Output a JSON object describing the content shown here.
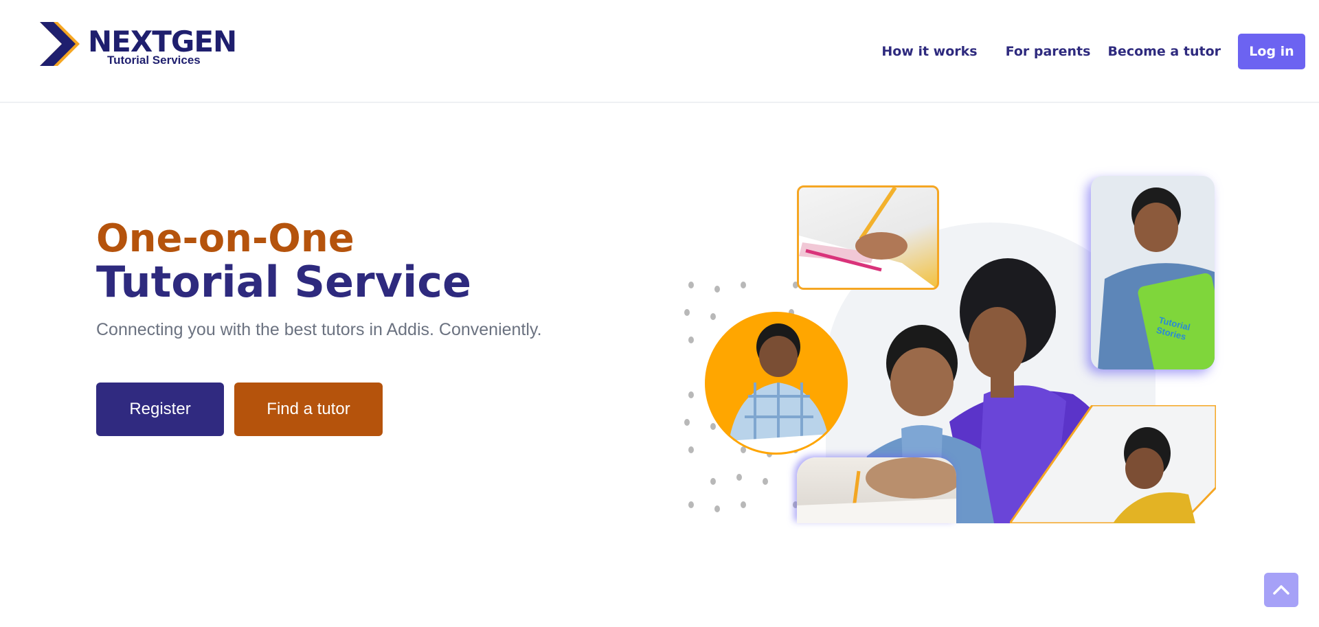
{
  "brand": {
    "name": "NEXTGEN",
    "subtitle": "Tutorial Services",
    "colors": {
      "navy": "#2e2a7e",
      "orange": "#b5530c",
      "accent": "#6c63f1",
      "gold": "#f5a623"
    }
  },
  "nav": {
    "items": [
      {
        "label": "How it works"
      },
      {
        "label": "For parents"
      },
      {
        "label": "Become a tutor"
      }
    ],
    "login_label": "Log in"
  },
  "hero": {
    "title_line1": "One-on-One",
    "title_line2": "Tutorial Service",
    "tagline": "Connecting you with the best tutors in Addis. Conveniently.",
    "primary_button": "Register",
    "secondary_button": "Find a tutor"
  },
  "collage": {
    "book_cover_text": "Tutorial Stories"
  },
  "icons": {
    "logo": "chevron-logo-icon",
    "back_to_top": "chevron-up-icon"
  }
}
